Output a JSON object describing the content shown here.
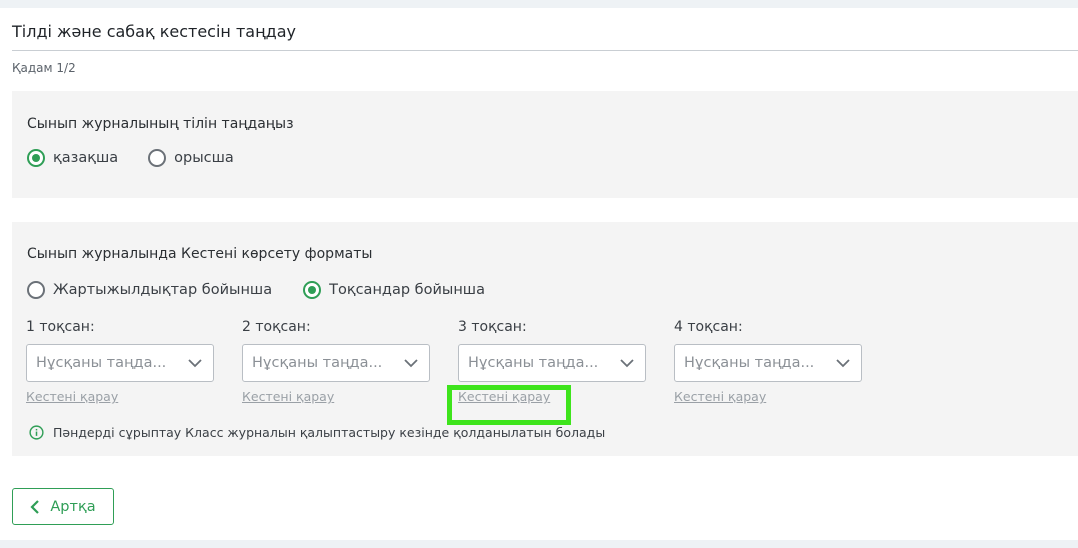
{
  "header": {
    "title": "Тілді және сабақ кестесін таңдау",
    "step": "Қадам 1/2"
  },
  "language_section": {
    "heading": "Сынып журналының тілін таңдаңыз",
    "options": [
      {
        "label": "қазақша",
        "checked": true
      },
      {
        "label": "орысша",
        "checked": false
      }
    ]
  },
  "format_section": {
    "heading": "Сынып журналында Кестені көрсету форматы",
    "options": [
      {
        "label": "Жартыжылдықтар бойынша",
        "checked": false
      },
      {
        "label": "Тоқсандар бойынша",
        "checked": true
      }
    ],
    "quarters": [
      {
        "label": "1 тоқсан:",
        "placeholder": "Нұсқаны таңда...",
        "link": "Кестені қарау"
      },
      {
        "label": "2 тоқсан:",
        "placeholder": "Нұсқаны таңда...",
        "link": "Кестені қарау"
      },
      {
        "label": "3 тоқсан:",
        "placeholder": "Нұсқаны таңда...",
        "link": "Кестені қарау"
      },
      {
        "label": "4 тоқсан:",
        "placeholder": "Нұсқаны таңда...",
        "link": "Кестені қарау"
      }
    ],
    "info_text": "Пәндерді сұрыптау Класс журналын қалыптастыру кезінде қолданылатын болады"
  },
  "footer": {
    "back_label": "Артқа"
  },
  "colors": {
    "accent": "#2f9e56",
    "panel_bg": "#f4f4f4",
    "highlight": "#3ee41c",
    "link": "#9aa0a6"
  },
  "icons": {
    "radio_checked": "radio-checked-icon",
    "radio_unchecked": "radio-unchecked-icon",
    "chevron": "chevron-down-icon",
    "info": "info-circle-icon",
    "back": "chevron-left-icon"
  }
}
